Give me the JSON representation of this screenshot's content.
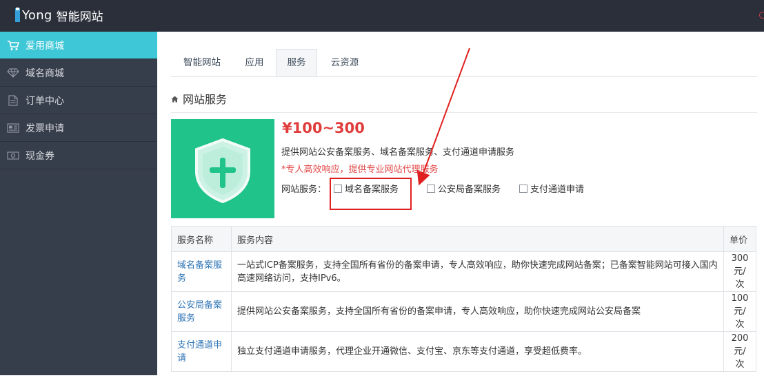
{
  "app": {
    "brand": "Yong",
    "title": "智能网站"
  },
  "sidebar": {
    "items": [
      {
        "label": "爱用商城",
        "icon": "cart-icon",
        "active": true
      },
      {
        "label": "域名商城",
        "icon": "diamond-icon",
        "active": false
      },
      {
        "label": "订单中心",
        "icon": "document-icon",
        "active": false
      },
      {
        "label": "发票申请",
        "icon": "invoice-icon",
        "active": false
      },
      {
        "label": "现金券",
        "icon": "coupon-icon",
        "active": false
      }
    ]
  },
  "tabs": [
    {
      "label": "智能网站",
      "active": false
    },
    {
      "label": "应用",
      "active": false
    },
    {
      "label": "服务",
      "active": true
    },
    {
      "label": "云资源",
      "active": false
    }
  ],
  "section": {
    "title": "网站服务"
  },
  "product": {
    "price": "¥100~300",
    "description": "提供网站公安备案服务、域名备案服务、支付通道申请服务",
    "note": "*专人高效响应，提供专业网站代理服务",
    "options_label": "网站服务：",
    "options": [
      {
        "label": "域名备案服务",
        "checked": false
      },
      {
        "label": "公安局备案服务",
        "checked": false
      },
      {
        "label": "支付通道申请",
        "checked": false
      }
    ]
  },
  "table": {
    "headers": [
      "服务名称",
      "服务内容",
      "单价"
    ],
    "rows": [
      {
        "name": "域名备案服务",
        "content": "一站式ICP备案服务，支持全国所有省份的备案申请，专人高效响应，助你快速完成网站备案；已备案智能网站可接入国内高速网络访问，支持IPv6。",
        "price": "300元/次"
      },
      {
        "name": "公安局备案服务",
        "content": "提供网站公安备案服务，支持全国所有省份的备案申请，专人高效响应，助你快速完成网站公安局备案",
        "price": "100元/次"
      },
      {
        "name": "支付通道申请",
        "content": "独立支付通道申请服务，代理企业开通微信、支付宝、京东等支付通道，享受超低费率。",
        "price": "200元/次"
      }
    ]
  },
  "colors": {
    "accent": "#3ec7d6",
    "sidebar_bg": "#373e4b",
    "topbar_bg": "#2a2f3a",
    "price_red": "#e03c3c",
    "product_green": "#20c38a",
    "link_blue": "#2e74b5",
    "annotation_red": "#e02020"
  }
}
